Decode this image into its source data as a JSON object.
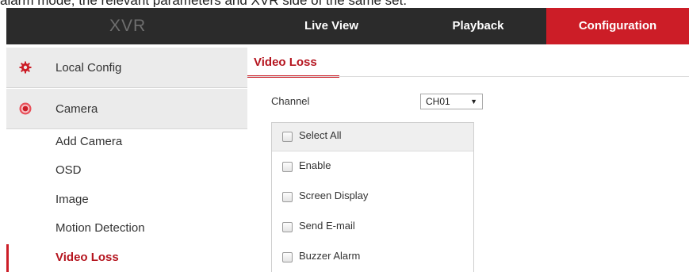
{
  "caption": "alarm mode, the relevant parameters and XVR side of the same set.",
  "header": {
    "brand": "XVR",
    "tabs": {
      "live_view": "Live View",
      "playback": "Playback",
      "configuration": "Configuration"
    },
    "active_tab": "configuration"
  },
  "sidebar": {
    "local_config": {
      "label": "Local Config",
      "icon": "gear-icon"
    },
    "camera": {
      "label": "Camera",
      "icon": "camera-dot-icon"
    },
    "items": [
      "Add Camera",
      "OSD",
      "Image",
      "Motion Detection",
      "Video Loss"
    ],
    "active_item": "Video Loss"
  },
  "main": {
    "tab": "Video Loss",
    "channel": {
      "label": "Channel",
      "value": "CH01"
    },
    "options": {
      "select_all": "Select All",
      "items": [
        "Enable",
        "Screen Display",
        "Send E-mail",
        "Buzzer Alarm"
      ]
    }
  },
  "colors": {
    "accent": "#cc1d27",
    "topbar": "#2b2b2b",
    "sidebar_header": "#ebebeb"
  }
}
